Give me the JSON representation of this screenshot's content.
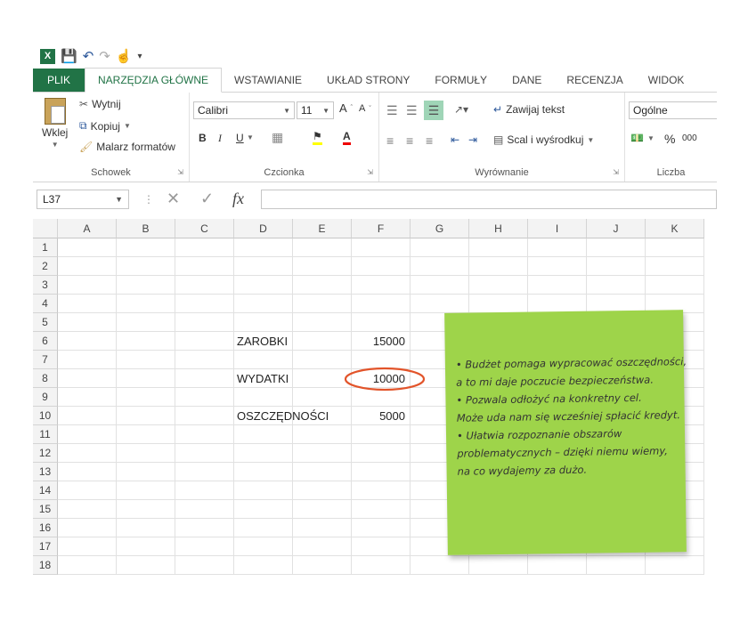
{
  "quick_access": {
    "icons": [
      "excel-icon",
      "save-icon",
      "undo-icon",
      "redo-icon",
      "touch-mode-icon",
      "customize-icon"
    ]
  },
  "tabs": [
    {
      "label": "PLIK"
    },
    {
      "label": "NARZĘDZIA GŁÓWNE"
    },
    {
      "label": "WSTAWIANIE"
    },
    {
      "label": "UKŁAD STRONY"
    },
    {
      "label": "FORMUŁY"
    },
    {
      "label": "DANE"
    },
    {
      "label": "RECENZJA"
    },
    {
      "label": "WIDOK"
    }
  ],
  "ribbon": {
    "clipboard": {
      "paste": "Wklej",
      "cut": "Wytnij",
      "copy": "Kopiuj",
      "format_painter": "Malarz formatów",
      "label": "Schowek"
    },
    "font": {
      "name": "Calibri",
      "size": "11",
      "bold": "B",
      "italic": "I",
      "underline": "U",
      "label": "Czcionka",
      "grow": "A",
      "shrink": "A",
      "font_color": "A"
    },
    "alignment": {
      "wrap": "Zawijaj tekst",
      "merge": "Scal i wyśrodkuj",
      "label": "Wyrównanie"
    },
    "number": {
      "format": "Ogólne",
      "percent": "%",
      "thousands": "000",
      "label": "Liczba"
    }
  },
  "formula_bar": {
    "name_box": "L37",
    "fx": "fx",
    "value": ""
  },
  "columns": [
    "A",
    "B",
    "C",
    "D",
    "E",
    "F",
    "G",
    "H",
    "I",
    "J",
    "K"
  ],
  "rows": [
    "1",
    "2",
    "3",
    "4",
    "5",
    "6",
    "7",
    "8",
    "9",
    "10",
    "11",
    "12",
    "13",
    "14",
    "15",
    "16",
    "17",
    "18"
  ],
  "cells": {
    "D6": "ZAROBKI",
    "F6": "15000",
    "D8": "WYDATKI",
    "F8": "10000",
    "D10": "OSZCZĘDNOŚCI",
    "F10": "5000"
  },
  "note": {
    "lines": [
      "• Budżet pomaga wypracować oszczędności,",
      "   a to mi daje poczucie bezpieczeństwa.",
      "• Pozwala odłożyć na konkretny cel.",
      "   Może uda nam się wcześniej spłacić kredyt.",
      "• Ułatwia rozpoznanie obszarów",
      "   problematycznych – dzięki niemu wiemy,",
      "   na co wydajemy za dużo."
    ],
    "color": "#9ed44a"
  },
  "colors": {
    "accent": "#217346",
    "highlight_circle": "#e2542a"
  }
}
